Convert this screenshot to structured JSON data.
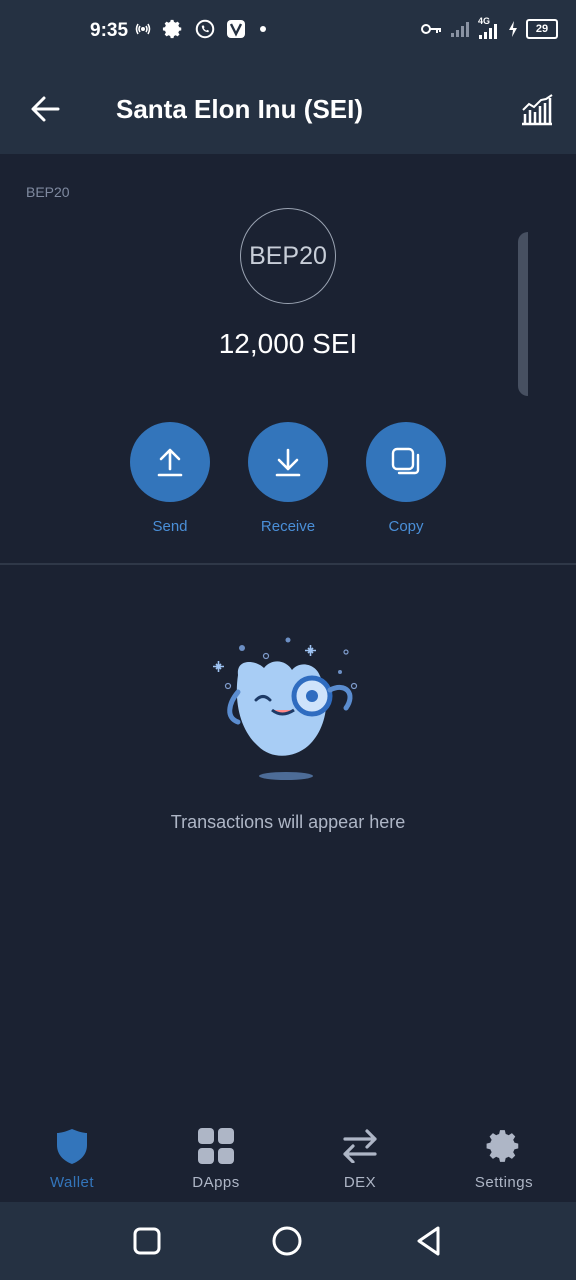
{
  "status_bar": {
    "time": "9:35",
    "battery": "29",
    "network_type": "4G"
  },
  "header": {
    "title": "Santa Elon Inu (SEI)"
  },
  "token": {
    "network_label": "BEP20",
    "icon_text": "BEP20",
    "balance": "12,000 SEI"
  },
  "actions": [
    {
      "label": "Send",
      "icon": "arrow-up-icon"
    },
    {
      "label": "Receive",
      "icon": "arrow-down-icon"
    },
    {
      "label": "Copy",
      "icon": "copy-icon"
    }
  ],
  "empty_state": {
    "message": "Transactions will appear here"
  },
  "bottom_nav": [
    {
      "label": "Wallet",
      "icon": "shield-icon",
      "active": true
    },
    {
      "label": "DApps",
      "icon": "grid-icon",
      "active": false
    },
    {
      "label": "DEX",
      "icon": "swap-icon",
      "active": false
    },
    {
      "label": "Settings",
      "icon": "gear-icon",
      "active": false
    }
  ],
  "colors": {
    "background": "#1b2232",
    "bar": "#253142",
    "accent": "#3375bb",
    "accent_text": "#4a8fd8",
    "inactive_nav": "#aeb6c6"
  }
}
